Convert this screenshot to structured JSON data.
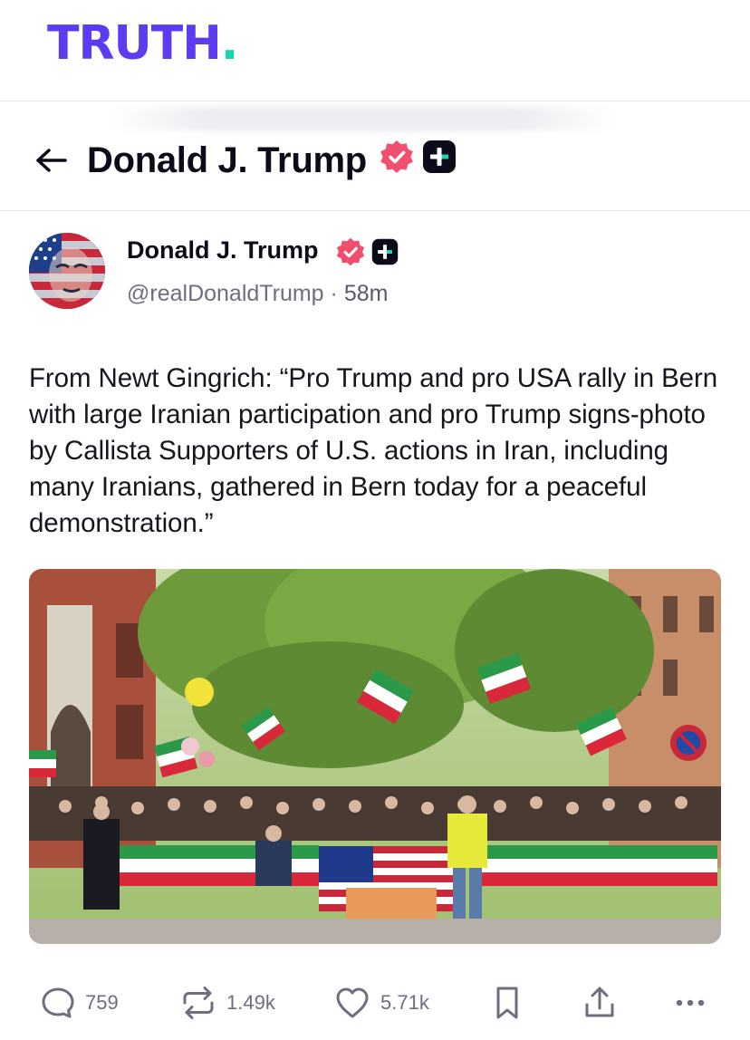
{
  "brand": {
    "name": "TRUTH",
    "dot": ".",
    "colors": {
      "primary": "#5b3cf0",
      "accent": "#17d4b0"
    }
  },
  "header": {
    "back_icon": "arrow-left-icon",
    "title": "Donald J. Trump",
    "badges": [
      "verified-badge-icon",
      "truth-plus-badge-icon"
    ]
  },
  "post": {
    "author": {
      "name": "Donald J. Trump",
      "handle": "@realDonaldTrump",
      "separator": "·",
      "time": "58m",
      "avatar": "avatar-image"
    },
    "text": "From Newt Gingrich: “Pro Trump and pro USA rally in Bern with large Iranian participation and pro Trump signs-photo by Callista Supporters of U.S. actions in Iran, including many Iranians, gathered in Bern today for a peaceful demonstration.”",
    "image": {
      "name": "rally-photo",
      "colors": {
        "verified": "#f0506e",
        "sky": "#d8e6b8",
        "foliage": "#6e9a3c"
      }
    },
    "actions": {
      "replies": "759",
      "retruths": "1.49k",
      "likes": "5.71k"
    }
  }
}
